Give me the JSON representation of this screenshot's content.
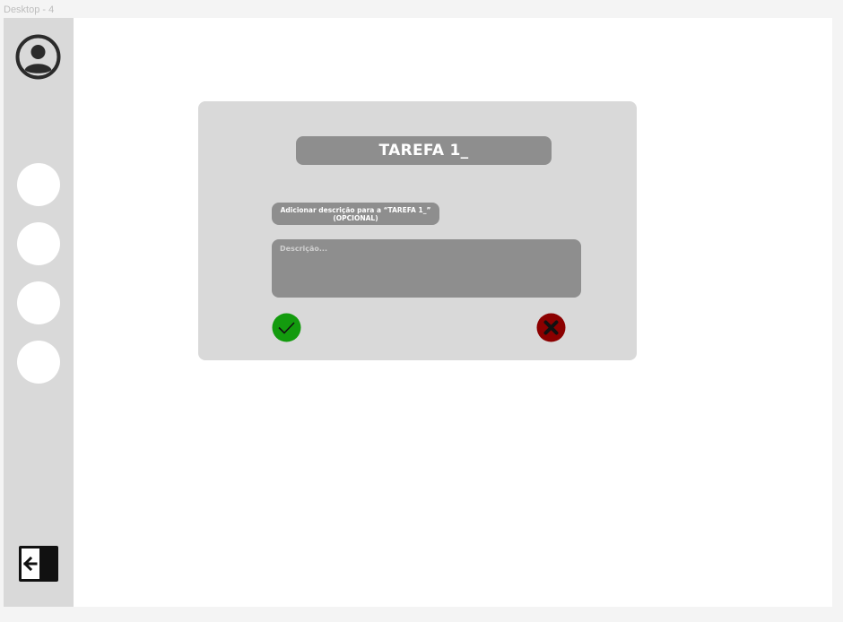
{
  "frame": {
    "label": "Desktop - 4"
  },
  "sidebar": {
    "avatar_icon": "user-circle-icon",
    "nav_items": [
      {
        "icon": "circle"
      },
      {
        "icon": "circle"
      },
      {
        "icon": "circle"
      },
      {
        "icon": "circle"
      }
    ],
    "exit_icon": "arrow-left-exit-icon"
  },
  "modal": {
    "title": "TAREFA 1_",
    "description_label_line1": "Adicionar descrição para a “TAREFA 1_”",
    "description_label_line2": "(OPCIONAL)",
    "description_placeholder": "Descrição...",
    "confirm_icon": "checkmark-icon",
    "cancel_icon": "close-icon"
  },
  "colors": {
    "background": "#f4f4f4",
    "frame": "#ffffff",
    "sidebar": "#d9d9d9",
    "modal": "#d9d9d9",
    "field": "#8e8e8e",
    "confirm": "#139b0e",
    "cancel": "#8b0000"
  }
}
